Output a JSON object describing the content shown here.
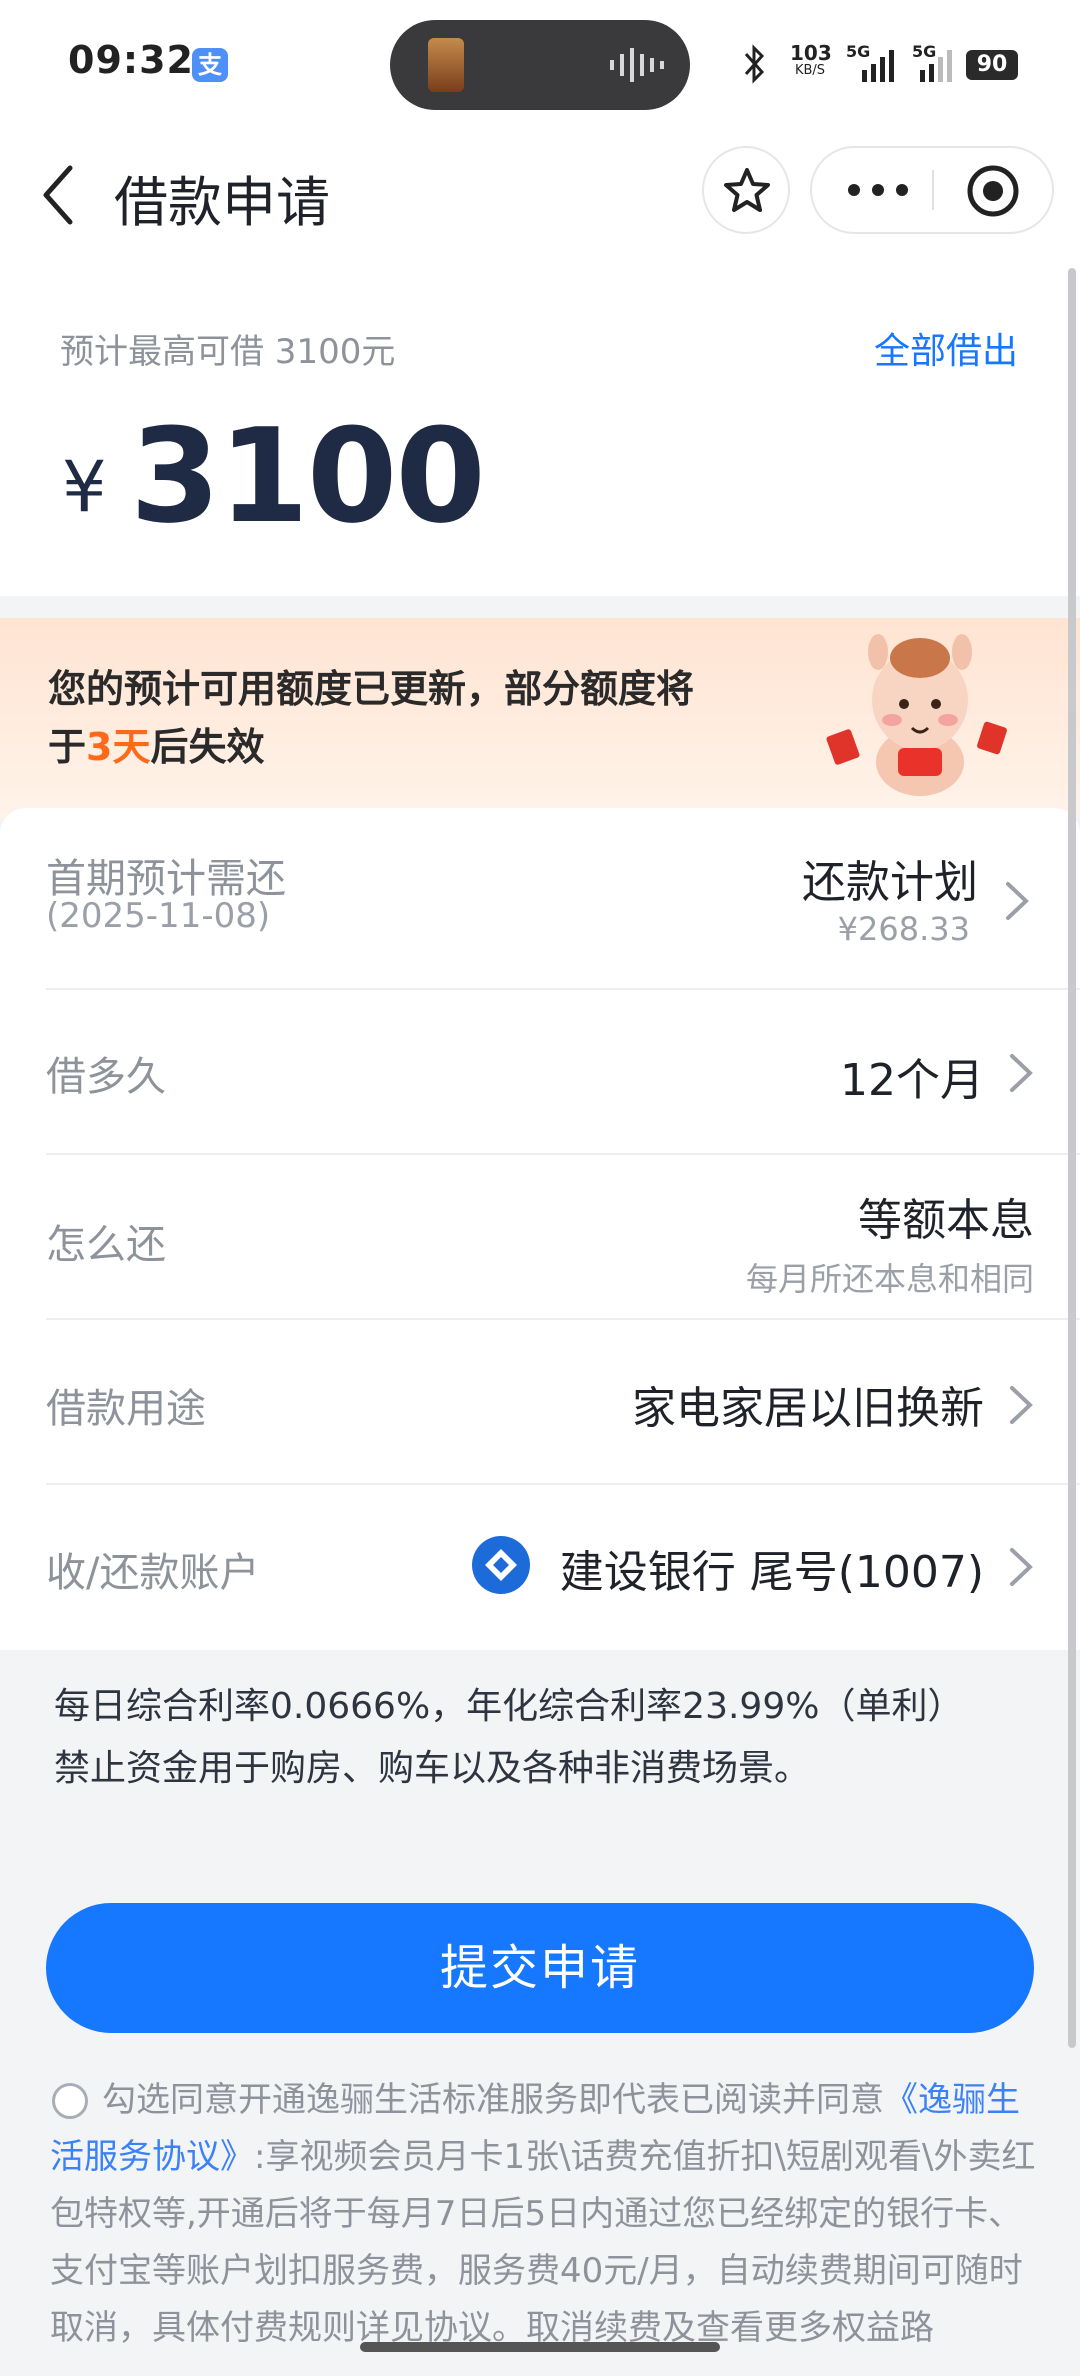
{
  "status_bar": {
    "time": "09:32",
    "app_badge": "支",
    "net_speed_value": "103",
    "net_speed_unit": "KB/S",
    "sim1": "5G",
    "sim2": "5G",
    "battery": "90"
  },
  "nav": {
    "title": "借款申请",
    "icons": [
      "back-icon",
      "star-icon",
      "more-icon",
      "close-target-icon"
    ]
  },
  "amount_card": {
    "max_text": "预计最高可借 3100元",
    "borrow_all": "全部借出",
    "currency": "¥",
    "amount": "3100"
  },
  "banner": {
    "text_before": "您的预计可用额度已更新，部分额度将于",
    "highlight": "3天",
    "text_after": "后失效"
  },
  "rows": {
    "first_repay": {
      "label": "首期预计需还",
      "date": "(2025-11-08)",
      "value": "还款计划",
      "hint": "¥268.33"
    },
    "term": {
      "label": "借多久",
      "value": "12个月"
    },
    "method": {
      "label": "怎么还",
      "value": "等额本息",
      "hint": "每月所还本息和相同"
    },
    "purpose": {
      "label": "借款用途",
      "value": "家电家居以旧换新"
    },
    "account": {
      "label": "收/还款账户",
      "value": "建设银行 尾号(1007)"
    }
  },
  "info": {
    "line1": "每日综合利率0.0666%，年化综合利率23.99%（单利）",
    "line2": "禁止资金用于购房、购车以及各种非消费场景。"
  },
  "submit_label": "提交申请",
  "agreement": {
    "prefix": "勾选同意开通逸骊生活标准服务即代表已阅读并同意",
    "link": "《逸骊生活服务协议》",
    "suffix": ":享视频会员月卡1张\\话费充值折扣\\短剧观看\\外卖红包特权等,开通后将于每月7日后5日内通过您已经绑定的银行卡、支付宝等账户划扣服务费，服务费40元/月，自动续费期间可随时取消，具体付费规则详见协议。取消续费及查看更多权益路"
  },
  "colors": {
    "primary": "#1677ff",
    "highlight": "#ff6a1a",
    "amount": "#1f2a44"
  }
}
